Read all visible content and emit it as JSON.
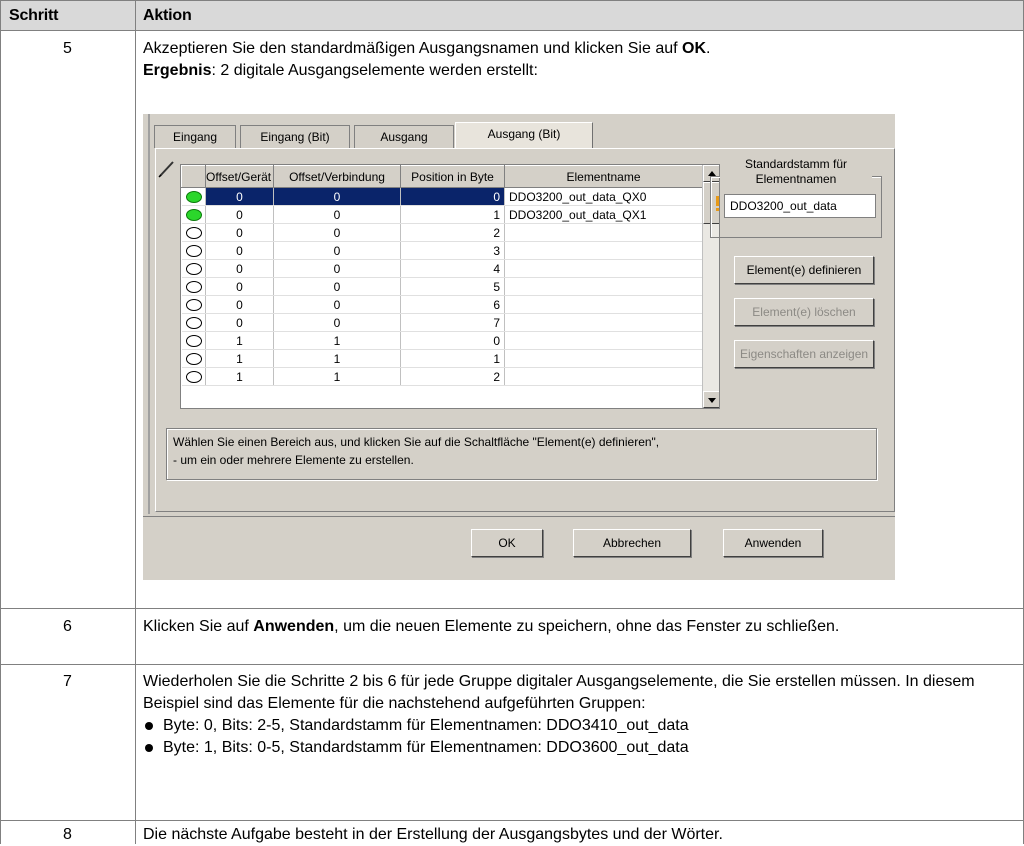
{
  "header": {
    "col_step": "Schritt",
    "col_action": "Aktion"
  },
  "rows": [
    {
      "step": "5",
      "line1_pre": "Akzeptieren Sie den standardmäßigen Ausgangsnamen und klicken Sie auf ",
      "line1_bold": "OK",
      "line1_post": ".",
      "line2_bold": "Ergebnis",
      "line2_post": ": 2 digitale Ausgangselemente werden erstellt:"
    },
    {
      "step": "6",
      "pre": "Klicken Sie auf ",
      "bold": "Anwenden",
      "post": ", um die neuen Elemente zu speichern, ohne das Fenster zu schließen."
    },
    {
      "step": "7",
      "text": "Wiederholen Sie die Schritte 2 bis 6 für jede Gruppe digitaler Ausgangselemente, die Sie erstellen müssen. In diesem Beispiel sind das Elemente für die nachstehend aufgeführten Gruppen:",
      "bullets": [
        "Byte: 0, Bits: 2-5, Standardstamm für Elementnamen: DDO3410_out_data",
        "Byte: 1, Bits: 0-5, Standardstamm für Elementnamen: DDO3600_out_data"
      ]
    },
    {
      "step": "8",
      "text": "Die nächste Aufgabe besteht in der Erstellung der Ausgangsbytes und der Wörter."
    }
  ],
  "dialog": {
    "tabs": [
      "Eingang",
      "Eingang (Bit)",
      "Ausgang",
      "Ausgang (Bit)"
    ],
    "active_tab": "Ausgang (Bit)",
    "grid_columns": [
      "Offset/Gerät",
      "Offset/Verbindung",
      "Position in Byte",
      "Elementname"
    ],
    "grid_rows": [
      {
        "led": "on",
        "offset_device": "0",
        "offset_conn": "0",
        "position": "0",
        "name": "DDO3200_out_data_QX0",
        "selected": true
      },
      {
        "led": "on",
        "offset_device": "0",
        "offset_conn": "0",
        "position": "1",
        "name": "DDO3200_out_data_QX1",
        "selected": false
      },
      {
        "led": "off",
        "offset_device": "0",
        "offset_conn": "0",
        "position": "2",
        "name": "",
        "selected": false
      },
      {
        "led": "off",
        "offset_device": "0",
        "offset_conn": "0",
        "position": "3",
        "name": "",
        "selected": false
      },
      {
        "led": "off",
        "offset_device": "0",
        "offset_conn": "0",
        "position": "4",
        "name": "",
        "selected": false
      },
      {
        "led": "off",
        "offset_device": "0",
        "offset_conn": "0",
        "position": "5",
        "name": "",
        "selected": false
      },
      {
        "led": "off",
        "offset_device": "0",
        "offset_conn": "0",
        "position": "6",
        "name": "",
        "selected": false
      },
      {
        "led": "off",
        "offset_device": "0",
        "offset_conn": "0",
        "position": "7",
        "name": "",
        "selected": false
      },
      {
        "led": "off",
        "offset_device": "1",
        "offset_conn": "1",
        "position": "0",
        "name": "",
        "selected": false
      },
      {
        "led": "off",
        "offset_device": "1",
        "offset_conn": "1",
        "position": "1",
        "name": "",
        "selected": false
      },
      {
        "led": "off",
        "offset_device": "1",
        "offset_conn": "1",
        "position": "2",
        "name": "",
        "selected": false
      }
    ],
    "name_root_group_title": "Standardstamm für Elementnamen",
    "name_root_value": "DDO3200_out_data",
    "btn_define": "Element(e) definieren",
    "btn_delete": "Element(e) löschen",
    "btn_properties": "Eigenschaften anzeigen",
    "hint_line1": "Wählen Sie einen Bereich aus, und klicken Sie auf die Schaltfläche \"Element(e) definieren\",",
    "hint_line2": "- um ein oder mehrere Elemente zu erstellen.",
    "btn_ok": "OK",
    "btn_cancel": "Abbrechen",
    "btn_apply": "Anwenden",
    "colors": {
      "selection": "#0a246a",
      "led_on": "#2bd62b",
      "dialog_bg": "#d4d0c8"
    }
  }
}
